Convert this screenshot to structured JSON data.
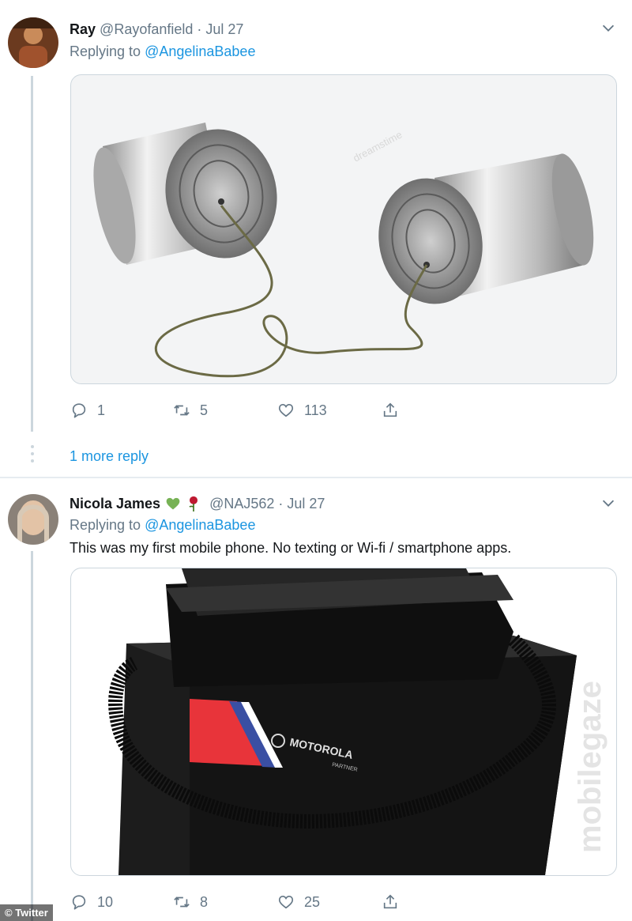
{
  "tweets": [
    {
      "name": "Ray",
      "handle": "@Rayofanfield",
      "date": "· Jul 27",
      "replying_prefix": "Replying to",
      "replying_to": "@AngelinaBabee",
      "text": "",
      "media_watermark": "dreamstime",
      "actions": {
        "replies": "1",
        "retweets": "5",
        "likes": "113"
      },
      "more_replies": "1 more reply"
    },
    {
      "name": "Nicola James",
      "emojis": [
        "green-heart-icon",
        "rose-icon"
      ],
      "handle": "@NAJ562",
      "date": "· Jul 27",
      "replying_prefix": "Replying to",
      "replying_to": "@AngelinaBabee",
      "text": "This was my first mobile phone. No texting or Wi-fi / smartphone apps.",
      "media_watermark": "mobilegaze",
      "phone_brand": "MOTOROLA",
      "phone_model": "PARTNER",
      "actions": {
        "replies": "10",
        "retweets": "8",
        "likes": "25"
      }
    }
  ],
  "source_badge": "© Twitter",
  "colors": {
    "link": "#1b95e0",
    "muted": "#657786",
    "border": "#e6ecf0"
  }
}
